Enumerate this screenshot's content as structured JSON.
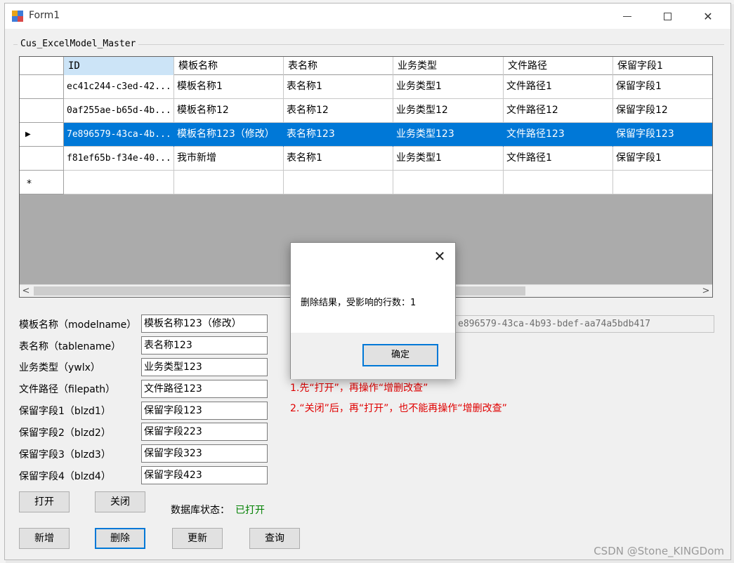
{
  "window": {
    "title": "Form1"
  },
  "groupbox": {
    "label": "Cus_ExcelModel_Master"
  },
  "grid": {
    "columns": [
      "ID",
      "模板名称",
      "表名称",
      "业务类型",
      "文件路径",
      "保留字段1"
    ],
    "rows": [
      [
        "ec41c244-c3ed-42...",
        "模板名称1",
        "表名称1",
        "业务类型1",
        "文件路径1",
        "保留字段1"
      ],
      [
        "0af255ae-b65d-4b...",
        "模板名称12",
        "表名称12",
        "业务类型12",
        "文件路径12",
        "保留字段12"
      ],
      [
        "7e896579-43ca-4b...",
        "模板名称123（修改）",
        "表名称123",
        "业务类型123",
        "文件路径123",
        "保留字段123"
      ],
      [
        "f81ef65b-f34e-40...",
        "我市新增",
        "表名称1",
        "业务类型1",
        "文件路径1",
        "保留字段1"
      ]
    ],
    "selected_row_index": 2,
    "current_row_marker": "▶",
    "new_row_marker": "*",
    "scroll_left": "<",
    "scroll_right": ">"
  },
  "form": {
    "fields": [
      {
        "label": "模板名称（modelname）",
        "value": "模板名称123（修改）"
      },
      {
        "label": "表名称（tablename）",
        "value": "表名称123"
      },
      {
        "label": "业务类型（ywlx）",
        "value": "业务类型123"
      },
      {
        "label": "文件路径（filepath）",
        "value": "文件路径123"
      },
      {
        "label": "保留字段1（blzd1）",
        "value": "保留字段123"
      },
      {
        "label": "保留字段2（blzd2）",
        "value": "保留字段223"
      },
      {
        "label": "保留字段3（blzd3）",
        "value": "保留字段323"
      },
      {
        "label": "保留字段4（blzd4）",
        "value": "保留字段423"
      }
    ],
    "id_value": "e896579-43ca-4b93-bdef-aa74a5bdb417"
  },
  "buttons": {
    "open": "打开",
    "close": "关闭",
    "add": "新增",
    "delete": "删除",
    "update": "更新",
    "query": "查询"
  },
  "status": {
    "label": "数据库状态：",
    "value": "已打开",
    "value_color": "#008000"
  },
  "notes": [
    "1.先“打开”，再操作“增删改查”",
    "2.“关闭”后，再“打开”，也不能再操作“增删改查”"
  ],
  "dialog": {
    "message": "删除结果，受影响的行数：1",
    "ok_label": "确定",
    "close_glyph": "✕"
  },
  "watermark": "CSDN @Stone_KINGDom",
  "colors": {
    "selection": "#0078d7",
    "note": "#e00000"
  }
}
